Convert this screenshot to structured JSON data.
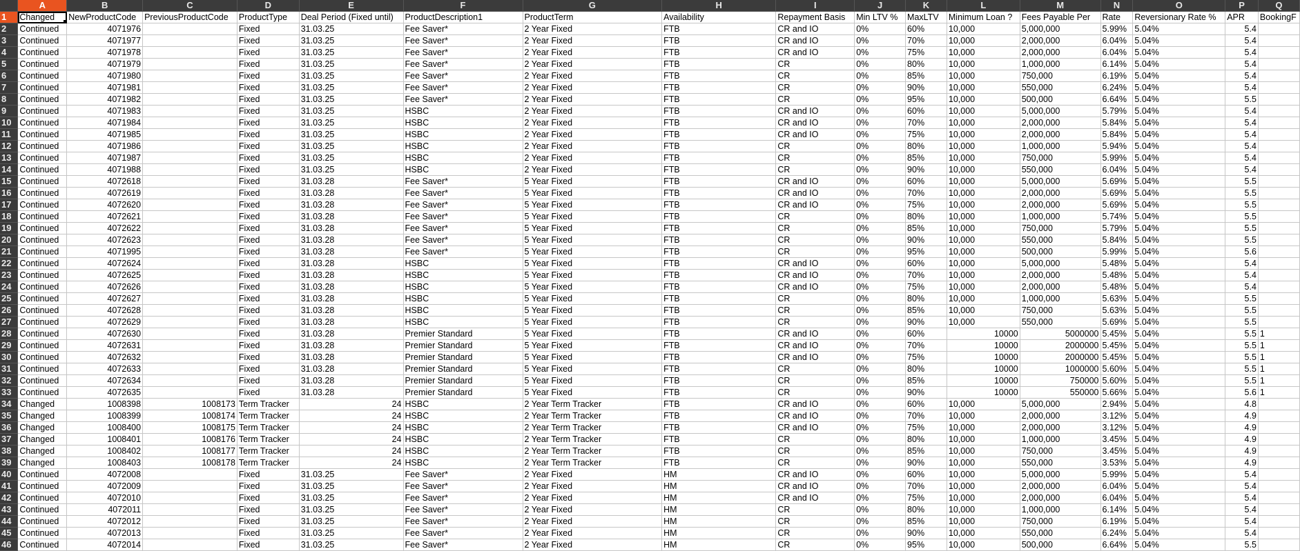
{
  "app": "Spreadsheet",
  "selected_cell": "A1",
  "columns": [
    "A",
    "B",
    "C",
    "D",
    "E",
    "F",
    "G",
    "H",
    "I",
    "J",
    "K",
    "L",
    "M",
    "N",
    "O",
    "P",
    "Q"
  ],
  "num_columns": [
    1,
    2,
    4,
    15
  ],
  "headers": [
    "Changed",
    "NewProductCode",
    "PreviousProductCode",
    "ProductType",
    "Deal Period (Fixed until)",
    "ProductDescription1",
    "ProductTerm",
    "Availability",
    "Repayment Basis",
    "Min LTV %",
    "MaxLTV",
    "Minimum Loan ?",
    "Fees Payable Per",
    "Rate",
    "Reversionary Rate %",
    "APR",
    "BookingF"
  ],
  "rows": [
    [
      "Continued",
      "4071976",
      "",
      "Fixed",
      "31.03.25",
      "Fee Saver*",
      "2 Year Fixed",
      "FTB",
      "CR and IO",
      "0%",
      "60%",
      "10,000",
      "5,000,000",
      "5.99%",
      "5.04%",
      "5.4",
      ""
    ],
    [
      "Continued",
      "4071977",
      "",
      "Fixed",
      "31.03.25",
      "Fee Saver*",
      "2 Year Fixed",
      "FTB",
      "CR and IO",
      "0%",
      "70%",
      "10,000",
      "2,000,000",
      "6.04%",
      "5.04%",
      "5.4",
      ""
    ],
    [
      "Continued",
      "4071978",
      "",
      "Fixed",
      "31.03.25",
      "Fee Saver*",
      "2 Year Fixed",
      "FTB",
      "CR and IO",
      "0%",
      "75%",
      "10,000",
      "2,000,000",
      "6.04%",
      "5.04%",
      "5.4",
      ""
    ],
    [
      "Continued",
      "4071979",
      "",
      "Fixed",
      "31.03.25",
      "Fee Saver*",
      "2 Year Fixed",
      "FTB",
      "CR",
      "0%",
      "80%",
      "10,000",
      "1,000,000",
      "6.14%",
      "5.04%",
      "5.4",
      ""
    ],
    [
      "Continued",
      "4071980",
      "",
      "Fixed",
      "31.03.25",
      "Fee Saver*",
      "2 Year Fixed",
      "FTB",
      "CR",
      "0%",
      "85%",
      "10,000",
      "750,000",
      "6.19%",
      "5.04%",
      "5.4",
      ""
    ],
    [
      "Continued",
      "4071981",
      "",
      "Fixed",
      "31.03.25",
      "Fee Saver*",
      "2 Year Fixed",
      "FTB",
      "CR",
      "0%",
      "90%",
      "10,000",
      "550,000",
      "6.24%",
      "5.04%",
      "5.4",
      ""
    ],
    [
      "Continued",
      "4071982",
      "",
      "Fixed",
      "31.03.25",
      "Fee Saver*",
      "2 Year Fixed",
      "FTB",
      "CR",
      "0%",
      "95%",
      "10,000",
      "500,000",
      "6.64%",
      "5.04%",
      "5.5",
      ""
    ],
    [
      "Continued",
      "4071983",
      "",
      "Fixed",
      "31.03.25",
      "HSBC",
      "2 Year Fixed",
      "FTB",
      "CR and IO",
      "0%",
      "60%",
      "10,000",
      "5,000,000",
      "5.79%",
      "5.04%",
      "5.4",
      ""
    ],
    [
      "Continued",
      "4071984",
      "",
      "Fixed",
      "31.03.25",
      "HSBC",
      "2 Year Fixed",
      "FTB",
      "CR and IO",
      "0%",
      "70%",
      "10,000",
      "2,000,000",
      "5.84%",
      "5.04%",
      "5.4",
      ""
    ],
    [
      "Continued",
      "4071985",
      "",
      "Fixed",
      "31.03.25",
      "HSBC",
      "2 Year Fixed",
      "FTB",
      "CR and IO",
      "0%",
      "75%",
      "10,000",
      "2,000,000",
      "5.84%",
      "5.04%",
      "5.4",
      ""
    ],
    [
      "Continued",
      "4071986",
      "",
      "Fixed",
      "31.03.25",
      "HSBC",
      "2 Year Fixed",
      "FTB",
      "CR",
      "0%",
      "80%",
      "10,000",
      "1,000,000",
      "5.94%",
      "5.04%",
      "5.4",
      ""
    ],
    [
      "Continued",
      "4071987",
      "",
      "Fixed",
      "31.03.25",
      "HSBC",
      "2 Year Fixed",
      "FTB",
      "CR",
      "0%",
      "85%",
      "10,000",
      "750,000",
      "5.99%",
      "5.04%",
      "5.4",
      ""
    ],
    [
      "Continued",
      "4071988",
      "",
      "Fixed",
      "31.03.25",
      "HSBC",
      "2 Year Fixed",
      "FTB",
      "CR",
      "0%",
      "90%",
      "10,000",
      "550,000",
      "6.04%",
      "5.04%",
      "5.4",
      ""
    ],
    [
      "Continued",
      "4072618",
      "",
      "Fixed",
      "31.03.28",
      "Fee Saver*",
      "5 Year Fixed",
      "FTB",
      "CR and IO",
      "0%",
      "60%",
      "10,000",
      "5,000,000",
      "5.69%",
      "5.04%",
      "5.5",
      ""
    ],
    [
      "Continued",
      "4072619",
      "",
      "Fixed",
      "31.03.28",
      "Fee Saver*",
      "5 Year Fixed",
      "FTB",
      "CR and IO",
      "0%",
      "70%",
      "10,000",
      "2,000,000",
      "5.69%",
      "5.04%",
      "5.5",
      ""
    ],
    [
      "Continued",
      "4072620",
      "",
      "Fixed",
      "31.03.28",
      "Fee Saver*",
      "5 Year Fixed",
      "FTB",
      "CR and IO",
      "0%",
      "75%",
      "10,000",
      "2,000,000",
      "5.69%",
      "5.04%",
      "5.5",
      ""
    ],
    [
      "Continued",
      "4072621",
      "",
      "Fixed",
      "31.03.28",
      "Fee Saver*",
      "5 Year Fixed",
      "FTB",
      "CR",
      "0%",
      "80%",
      "10,000",
      "1,000,000",
      "5.74%",
      "5.04%",
      "5.5",
      ""
    ],
    [
      "Continued",
      "4072622",
      "",
      "Fixed",
      "31.03.28",
      "Fee Saver*",
      "5 Year Fixed",
      "FTB",
      "CR",
      "0%",
      "85%",
      "10,000",
      "750,000",
      "5.79%",
      "5.04%",
      "5.5",
      ""
    ],
    [
      "Continued",
      "4072623",
      "",
      "Fixed",
      "31.03.28",
      "Fee Saver*",
      "5 Year Fixed",
      "FTB",
      "CR",
      "0%",
      "90%",
      "10,000",
      "550,000",
      "5.84%",
      "5.04%",
      "5.5",
      ""
    ],
    [
      "Continued",
      "4071995",
      "",
      "Fixed",
      "31.03.28",
      "Fee Saver*",
      "5 Year Fixed",
      "FTB",
      "CR",
      "0%",
      "95%",
      "10,000",
      "500,000",
      "5.99%",
      "5.04%",
      "5.6",
      ""
    ],
    [
      "Continued",
      "4072624",
      "",
      "Fixed",
      "31.03.28",
      "HSBC",
      "5 Year Fixed",
      "FTB",
      "CR and IO",
      "0%",
      "60%",
      "10,000",
      "5,000,000",
      "5.48%",
      "5.04%",
      "5.4",
      ""
    ],
    [
      "Continued",
      "4072625",
      "",
      "Fixed",
      "31.03.28",
      "HSBC",
      "5 Year Fixed",
      "FTB",
      "CR and IO",
      "0%",
      "70%",
      "10,000",
      "2,000,000",
      "5.48%",
      "5.04%",
      "5.4",
      ""
    ],
    [
      "Continued",
      "4072626",
      "",
      "Fixed",
      "31.03.28",
      "HSBC",
      "5 Year Fixed",
      "FTB",
      "CR and IO",
      "0%",
      "75%",
      "10,000",
      "2,000,000",
      "5.48%",
      "5.04%",
      "5.4",
      ""
    ],
    [
      "Continued",
      "4072627",
      "",
      "Fixed",
      "31.03.28",
      "HSBC",
      "5 Year Fixed",
      "FTB",
      "CR",
      "0%",
      "80%",
      "10,000",
      "1,000,000",
      "5.63%",
      "5.04%",
      "5.5",
      ""
    ],
    [
      "Continued",
      "4072628",
      "",
      "Fixed",
      "31.03.28",
      "HSBC",
      "5 Year Fixed",
      "FTB",
      "CR",
      "0%",
      "85%",
      "10,000",
      "750,000",
      "5.63%",
      "5.04%",
      "5.5",
      ""
    ],
    [
      "Continued",
      "4072629",
      "",
      "Fixed",
      "31.03.28",
      "HSBC",
      "5 Year Fixed",
      "FTB",
      "CR",
      "0%",
      "90%",
      "10,000",
      "550,000",
      "5.69%",
      "5.04%",
      "5.5",
      ""
    ],
    [
      "Continued",
      "4072630",
      "",
      "Fixed",
      "31.03.28",
      "Premier Standard",
      "5 Year Fixed",
      "FTB",
      "CR and IO",
      "0%",
      "60%",
      "10000",
      "5000000",
      "5.45%",
      "5.04%",
      "5.5",
      "1"
    ],
    [
      "Continued",
      "4072631",
      "",
      "Fixed",
      "31.03.28",
      "Premier Standard",
      "5 Year Fixed",
      "FTB",
      "CR and IO",
      "0%",
      "70%",
      "10000",
      "2000000",
      "5.45%",
      "5.04%",
      "5.5",
      "1"
    ],
    [
      "Continued",
      "4072632",
      "",
      "Fixed",
      "31.03.28",
      "Premier Standard",
      "5 Year Fixed",
      "FTB",
      "CR and IO",
      "0%",
      "75%",
      "10000",
      "2000000",
      "5.45%",
      "5.04%",
      "5.5",
      "1"
    ],
    [
      "Continued",
      "4072633",
      "",
      "Fixed",
      "31.03.28",
      "Premier Standard",
      "5 Year Fixed",
      "FTB",
      "CR",
      "0%",
      "80%",
      "10000",
      "1000000",
      "5.60%",
      "5.04%",
      "5.5",
      "1"
    ],
    [
      "Continued",
      "4072634",
      "",
      "Fixed",
      "31.03.28",
      "Premier Standard",
      "5 Year Fixed",
      "FTB",
      "CR",
      "0%",
      "85%",
      "10000",
      "750000",
      "5.60%",
      "5.04%",
      "5.5",
      "1"
    ],
    [
      "Continued",
      "4072635",
      "",
      "Fixed",
      "31.03.28",
      "Premier Standard",
      "5 Year Fixed",
      "FTB",
      "CR",
      "0%",
      "90%",
      "10000",
      "550000",
      "5.66%",
      "5.04%",
      "5.6",
      "1"
    ],
    [
      "Changed",
      "1008398",
      "1008173",
      "Term Tracker",
      "24",
      "HSBC",
      "2 Year Term Tracker",
      "FTB",
      "CR and IO",
      "0%",
      "60%",
      "10,000",
      "5,000,000",
      "2.94%",
      "5.04%",
      "4.8",
      ""
    ],
    [
      "Changed",
      "1008399",
      "1008174",
      "Term Tracker",
      "24",
      "HSBC",
      "2 Year Term Tracker",
      "FTB",
      "CR and IO",
      "0%",
      "70%",
      "10,000",
      "2,000,000",
      "3.12%",
      "5.04%",
      "4.9",
      ""
    ],
    [
      "Changed",
      "1008400",
      "1008175",
      "Term Tracker",
      "24",
      "HSBC",
      "2 Year Term Tracker",
      "FTB",
      "CR and IO",
      "0%",
      "75%",
      "10,000",
      "2,000,000",
      "3.12%",
      "5.04%",
      "4.9",
      ""
    ],
    [
      "Changed",
      "1008401",
      "1008176",
      "Term Tracker",
      "24",
      "HSBC",
      "2 Year Term Tracker",
      "FTB",
      "CR",
      "0%",
      "80%",
      "10,000",
      "1,000,000",
      "3.45%",
      "5.04%",
      "4.9",
      ""
    ],
    [
      "Changed",
      "1008402",
      "1008177",
      "Term Tracker",
      "24",
      "HSBC",
      "2 Year Term Tracker",
      "FTB",
      "CR",
      "0%",
      "85%",
      "10,000",
      "750,000",
      "3.45%",
      "5.04%",
      "4.9",
      ""
    ],
    [
      "Changed",
      "1008403",
      "1008178",
      "Term Tracker",
      "24",
      "HSBC",
      "2 Year Term Tracker",
      "FTB",
      "CR",
      "0%",
      "90%",
      "10,000",
      "550,000",
      "3.53%",
      "5.04%",
      "4.9",
      ""
    ],
    [
      "Continued",
      "4072008",
      "",
      "Fixed",
      "31.03.25",
      "Fee Saver*",
      "2 Year Fixed",
      "HM",
      "CR and IO",
      "0%",
      "60%",
      "10,000",
      "5,000,000",
      "5.99%",
      "5.04%",
      "5.4",
      ""
    ],
    [
      "Continued",
      "4072009",
      "",
      "Fixed",
      "31.03.25",
      "Fee Saver*",
      "2 Year Fixed",
      "HM",
      "CR and IO",
      "0%",
      "70%",
      "10,000",
      "2,000,000",
      "6.04%",
      "5.04%",
      "5.4",
      ""
    ],
    [
      "Continued",
      "4072010",
      "",
      "Fixed",
      "31.03.25",
      "Fee Saver*",
      "2 Year Fixed",
      "HM",
      "CR and IO",
      "0%",
      "75%",
      "10,000",
      "2,000,000",
      "6.04%",
      "5.04%",
      "5.4",
      ""
    ],
    [
      "Continued",
      "4072011",
      "",
      "Fixed",
      "31.03.25",
      "Fee Saver*",
      "2 Year Fixed",
      "HM",
      "CR",
      "0%",
      "80%",
      "10,000",
      "1,000,000",
      "6.14%",
      "5.04%",
      "5.4",
      ""
    ],
    [
      "Continued",
      "4072012",
      "",
      "Fixed",
      "31.03.25",
      "Fee Saver*",
      "2 Year Fixed",
      "HM",
      "CR",
      "0%",
      "85%",
      "10,000",
      "750,000",
      "6.19%",
      "5.04%",
      "5.4",
      ""
    ],
    [
      "Continued",
      "4072013",
      "",
      "Fixed",
      "31.03.25",
      "Fee Saver*",
      "2 Year Fixed",
      "HM",
      "CR",
      "0%",
      "90%",
      "10,000",
      "550,000",
      "6.24%",
      "5.04%",
      "5.4",
      ""
    ],
    [
      "Continued",
      "4072014",
      "",
      "Fixed",
      "31.03.25",
      "Fee Saver*",
      "2 Year Fixed",
      "HM",
      "CR",
      "0%",
      "95%",
      "10,000",
      "500,000",
      "6.64%",
      "5.04%",
      "5.5",
      ""
    ]
  ],
  "colors": {
    "header_bg": "#3b3b3b",
    "header_fg": "#e8e8e8",
    "selected_header_bg": "#e95420",
    "gridline": "#c6c6c6"
  }
}
